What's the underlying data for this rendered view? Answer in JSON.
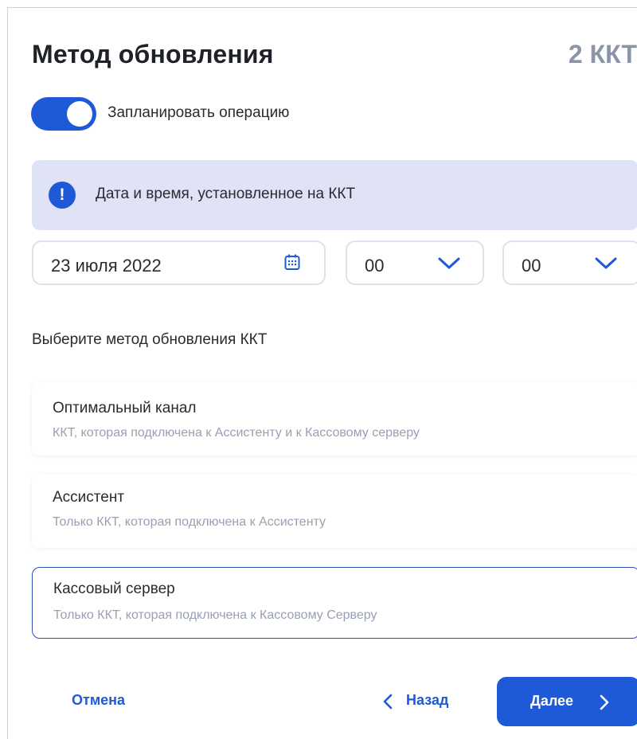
{
  "header": {
    "title": "Метод обновления",
    "count": "2 ККТ"
  },
  "schedule": {
    "toggle_on": true,
    "label": "Запланировать операцию"
  },
  "info": {
    "icon": "exclamation-icon",
    "text": "Дата и время, установленное на ККТ"
  },
  "datetime": {
    "date": "23 июля 2022",
    "hour": "00",
    "minute": "00"
  },
  "method": {
    "label": "Выберите метод обновления ККТ",
    "options": [
      {
        "title": "Оптимальный канал",
        "subtitle": "ККТ, которая подключена к Ассистенту и к Кассовому серверу",
        "selected": false
      },
      {
        "title": "Ассистент",
        "subtitle": "Только ККТ, которая подключена к Ассистенту",
        "selected": false
      },
      {
        "title": "Кассовый сервер",
        "subtitle": "Только ККТ, которая подключена к Кассовому Серверу",
        "selected": true
      }
    ]
  },
  "footer": {
    "cancel_label": "Отмена",
    "back_label": "Назад",
    "next_label": "Далее"
  },
  "colors": {
    "accent": "#1e5ad7",
    "info_bg": "#dfe3f5",
    "muted": "#8c94a8"
  }
}
